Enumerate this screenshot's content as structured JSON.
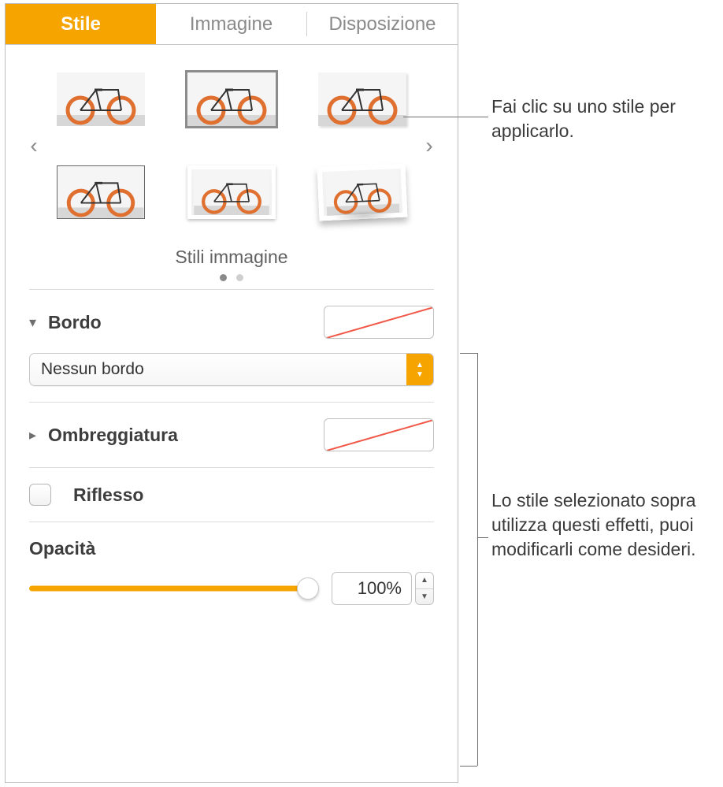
{
  "tabs": {
    "style": "Stile",
    "image": "Immagine",
    "layout": "Disposizione"
  },
  "styles": {
    "label": "Stili immagine"
  },
  "border": {
    "title": "Bordo",
    "popup_value": "Nessun bordo"
  },
  "shadow": {
    "title": "Ombreggiatura"
  },
  "reflection": {
    "title": "Riflesso"
  },
  "opacity": {
    "title": "Opacità",
    "value": "100%"
  },
  "callouts": {
    "c1": "Fai clic su uno stile per applicarlo.",
    "c2": "Lo stile selezionato sopra utilizza questi effetti, puoi modificarli come desideri."
  }
}
